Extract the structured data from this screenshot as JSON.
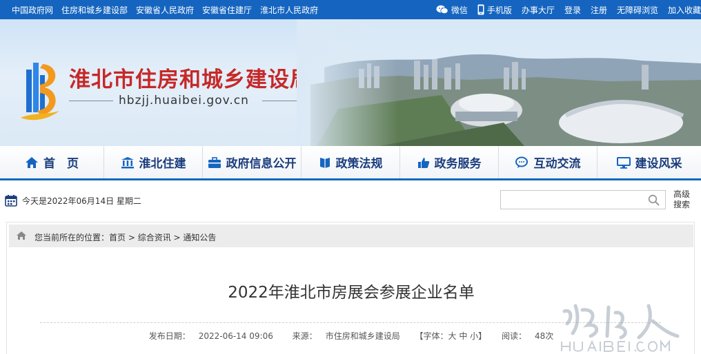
{
  "topbar": {
    "links": [
      "中国政府网",
      "住房和城乡建设部",
      "安徽省人民政府",
      "安徽省住建厅",
      "淮北市人民政府"
    ],
    "wechat": "微信",
    "mobile": "手机版",
    "hall": "办事大厅",
    "login": "登录",
    "register": "注册",
    "accessible": "无障碍浏览",
    "favorite": "加入收藏"
  },
  "banner": {
    "title": "淮北市住房和城乡建设局",
    "domain": "hbzjj.huaibei.gov.cn"
  },
  "nav": [
    {
      "label": "首　页",
      "icon": "home-icon"
    },
    {
      "label": "淮北住建",
      "icon": "building-icon"
    },
    {
      "label": "政府信息公开",
      "icon": "briefcase-icon"
    },
    {
      "label": "政策法规",
      "icon": "book-icon"
    },
    {
      "label": "政务服务",
      "icon": "thumbs-up-icon"
    },
    {
      "label": "互动交流",
      "icon": "chat-icon"
    },
    {
      "label": "建设风采",
      "icon": "monitor-icon"
    }
  ],
  "date_text": "今天是2022年06月14日 星期二",
  "search": {
    "placeholder": "",
    "advanced": "高级搜索"
  },
  "breadcrumb": {
    "prefix": "您当前所在的位置：",
    "items": [
      "首页",
      "综合资讯",
      "通知公告"
    ],
    "separator": " > "
  },
  "article": {
    "title": "2022年淮北市房展会参展企业名单",
    "publish_label": "发布日期：",
    "publish_date": "2022-06-14 09:06",
    "source_label": "来源：",
    "source": "市住房和城乡建设局",
    "font_label": "【字体：大 中 小】",
    "read_label": "阅读：",
    "read_count": "48次"
  },
  "watermark": {
    "script": "淮北人",
    "site": "HUAIBEI.COM"
  },
  "colors": {
    "topbar": "#1565c0",
    "title_red": "#c62828",
    "nav_text": "#1a3d7c"
  }
}
